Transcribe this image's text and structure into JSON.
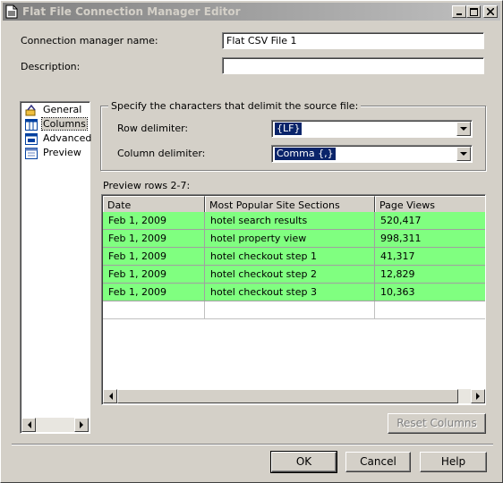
{
  "window": {
    "title": "Flat File Connection Manager Editor",
    "minimize_label": "_",
    "maximize_label": "□",
    "close_label": "×"
  },
  "form": {
    "name_label": "Connection manager name:",
    "name_value": "Flat CSV File 1",
    "description_label": "Description:",
    "description_value": ""
  },
  "nav": {
    "items": [
      {
        "label": "General",
        "icon": "general-icon",
        "selected": false
      },
      {
        "label": "Columns",
        "icon": "columns-icon",
        "selected": true
      },
      {
        "label": "Advanced",
        "icon": "advanced-icon",
        "selected": false
      },
      {
        "label": "Preview",
        "icon": "preview-icon",
        "selected": false
      }
    ]
  },
  "delimiters": {
    "group_title": "Specify the characters that delimit the source file:",
    "row_label": "Row delimiter:",
    "row_value": "{LF}",
    "column_label": "Column delimiter:",
    "column_value": "Comma {,}"
  },
  "preview": {
    "label": "Preview rows 2-7:",
    "columns": [
      "Date",
      "Most Popular Site Sections",
      "Page Views"
    ],
    "rows": [
      [
        "Feb  1, 2009",
        "hotel search results",
        "520,417"
      ],
      [
        "Feb  1, 2009",
        "hotel property view",
        "998,311"
      ],
      [
        "Feb  1, 2009",
        "hotel checkout step 1",
        "41,317"
      ],
      [
        "Feb  1, 2009",
        "hotel checkout step 2",
        "12,829"
      ],
      [
        "Feb  1, 2009",
        "hotel checkout step 3",
        "10,363"
      ]
    ],
    "row_highlight_color": "#80ff80"
  },
  "buttons": {
    "reset_columns": "Reset Columns",
    "ok": "OK",
    "cancel": "Cancel",
    "help": "Help"
  }
}
